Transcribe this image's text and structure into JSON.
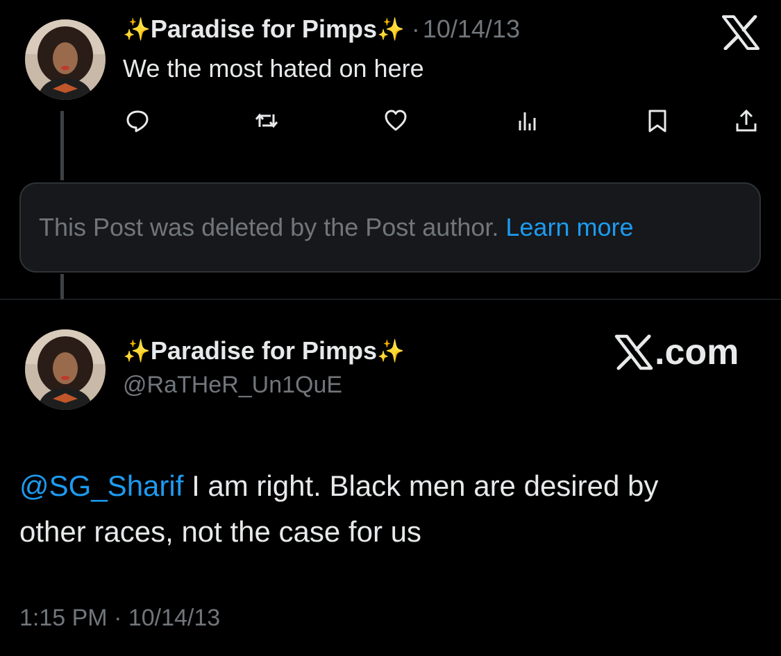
{
  "top_tweet": {
    "display_name": "Paradise for Pimps",
    "name_emoji": "✨",
    "separator": "·",
    "date": "10/14/13",
    "text": "We the most hated on here",
    "actions": [
      "reply-icon",
      "repost-icon",
      "like-icon",
      "views-icon",
      "bookmark-icon",
      "share-icon"
    ]
  },
  "deleted_notice": {
    "text": "This Post was deleted by the Post author.",
    "link": "Learn more"
  },
  "bottom_tweet": {
    "display_name": "Paradise for Pimps",
    "name_emoji": "✨",
    "handle": "@RaTHeR_Un1QuE",
    "brand": ".com",
    "mention": "@SG_Sharif",
    "body_line1": " I am right. Black men are desired by",
    "body_line2": "other races, not the case for us",
    "timestamp": "1:15 PM · 10/14/13"
  },
  "colors": {
    "background": "#000000",
    "text_primary": "#e7e9ea",
    "text_secondary": "#71767b",
    "accent": "#1d9bf0",
    "border": "#2f3336"
  }
}
